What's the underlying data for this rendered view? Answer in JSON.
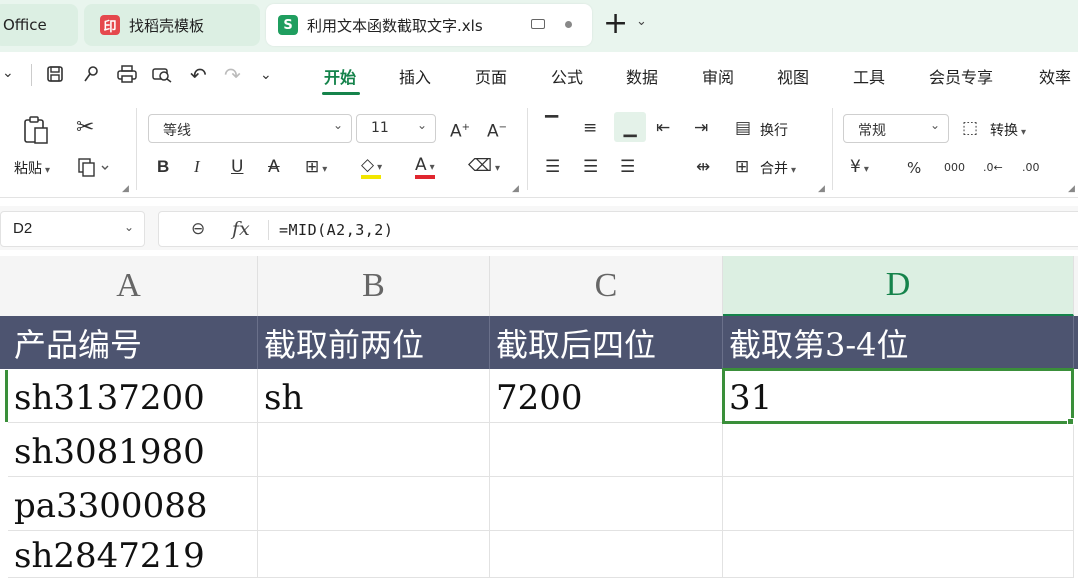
{
  "tabs": {
    "office": "Office",
    "template": "找稻壳模板",
    "template_badge": "印",
    "file": "利用文本函数截取文字.xls",
    "file_badge": "S"
  },
  "menu": [
    "开始",
    "插入",
    "页面",
    "公式",
    "数据",
    "审阅",
    "视图",
    "工具",
    "会员专享",
    "效率"
  ],
  "menu_active": "开始",
  "ribbon": {
    "paste": "粘贴",
    "font_name": "等线",
    "font_size": "11",
    "wrap": "换行",
    "merge": "合并",
    "number_format": "常规",
    "convert": "转换"
  },
  "formula_bar": {
    "cell_ref": "D2",
    "formula": "=MID(A2,3,2)"
  },
  "grid": {
    "columns": [
      "A",
      "B",
      "C",
      "D"
    ],
    "active_column": "D",
    "headers": [
      "产品编号",
      "截取前两位",
      "截取后四位",
      "截取第3-4位"
    ],
    "rows": [
      [
        "sh3137200",
        "sh",
        "7200",
        "31"
      ],
      [
        "sh3081980",
        "",
        "",
        ""
      ],
      [
        "pa3300088",
        "",
        "",
        ""
      ],
      [
        "sh2847219",
        "",
        "",
        ""
      ]
    ]
  },
  "colors": {
    "accent": "#15834b",
    "header_fill": "#4d5470",
    "highlight_yellow": "#f2e600",
    "font_red": "#e0262f",
    "selection_border": "#3a8f3a"
  },
  "icons": {
    "quick_access": [
      "save-icon",
      "pin-icon",
      "print-icon",
      "print-preview-icon",
      "undo-icon",
      "redo-icon",
      "more-icon"
    ]
  }
}
